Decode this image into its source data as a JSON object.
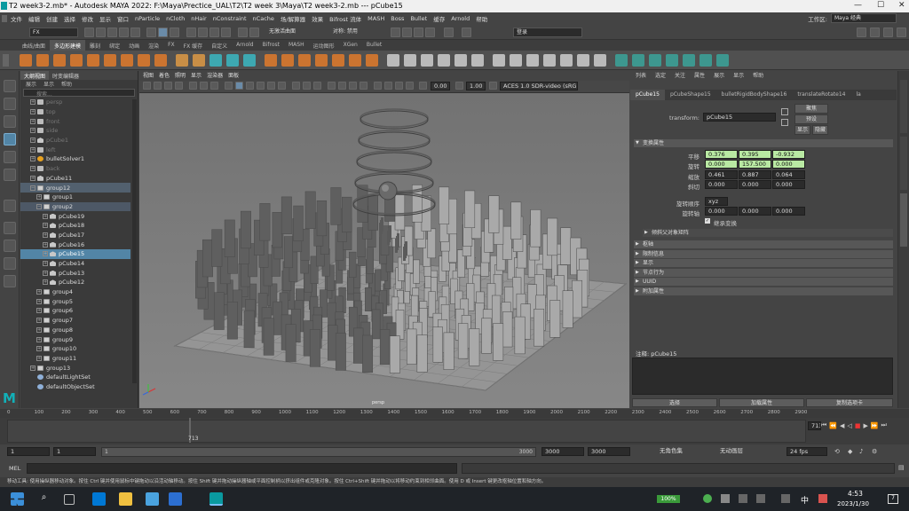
{
  "window": {
    "title": "T2 week3-2.mb* - Autodesk MAYA 2022: F:\\Maya\\Prectice_UAL\\T2\\T2 week 3\\Maya\\T2 week3-2.mb   ---   pCube15",
    "min": "—",
    "max": "☐",
    "close": "✕"
  },
  "menu": {
    "items": [
      "文件",
      "编辑",
      "创建",
      "选择",
      "修改",
      "显示",
      "窗口",
      "nParticle",
      "nCloth",
      "nHair",
      "nConstraint",
      "nCache",
      "场/解算器",
      "效果",
      "Bifrost 流体",
      "MASH",
      "Boss",
      "Bullet",
      "缓存",
      "Arnold",
      "帮助"
    ],
    "workspace_label": "工作区:",
    "workspace_value": "Maya 经典"
  },
  "status": {
    "mode": "FX",
    "live": "无激活曲面",
    "symmetry": "对称: 禁用",
    "login": "登录"
  },
  "shelf": {
    "tabs": [
      "曲线/曲面",
      "多边形建模",
      "雕刻",
      "绑定",
      "动画",
      "渲染",
      "FX",
      "FX 缓存",
      "自定义",
      "Arnold",
      "Bifrost",
      "MASH",
      "运动图形",
      "XGen",
      "Bullet"
    ],
    "active": 1
  },
  "outliner": {
    "tabs": [
      "大纲视图",
      "时变编辑器"
    ],
    "menu": [
      "展示",
      "显示",
      "帮助"
    ],
    "search_placeholder": "搜索...",
    "items": [
      {
        "label": "persp",
        "icon": "camera",
        "depth": 1,
        "dim": true
      },
      {
        "label": "top",
        "icon": "camera",
        "depth": 1,
        "dim": true
      },
      {
        "label": "front",
        "icon": "camera",
        "depth": 1,
        "dim": true
      },
      {
        "label": "side",
        "icon": "camera",
        "depth": 1,
        "dim": true
      },
      {
        "label": "pCube1",
        "icon": "mesh",
        "depth": 1,
        "dim": true
      },
      {
        "label": "left",
        "icon": "camera",
        "depth": 1,
        "dim": true
      },
      {
        "label": "bulletSolver1",
        "icon": "bullet",
        "depth": 1
      },
      {
        "label": "back",
        "icon": "camera",
        "depth": 1,
        "dim": true
      },
      {
        "label": "pCube11",
        "icon": "mesh",
        "depth": 1
      },
      {
        "label": "group12",
        "icon": "group",
        "depth": 1,
        "style": "grp",
        "open": true
      },
      {
        "label": "group1",
        "icon": "group",
        "depth": 2
      },
      {
        "label": "group2",
        "icon": "group",
        "depth": 2,
        "style": "grp2",
        "open": true
      },
      {
        "label": "pCube19",
        "icon": "mesh",
        "depth": 3
      },
      {
        "label": "pCube18",
        "icon": "mesh",
        "depth": 3
      },
      {
        "label": "pCube17",
        "icon": "mesh",
        "depth": 3
      },
      {
        "label": "pCube16",
        "icon": "mesh",
        "depth": 3
      },
      {
        "label": "pCube15",
        "icon": "mesh",
        "depth": 3,
        "style": "sel"
      },
      {
        "label": "pCube14",
        "icon": "mesh",
        "depth": 3
      },
      {
        "label": "pCube13",
        "icon": "mesh",
        "depth": 3
      },
      {
        "label": "pCube12",
        "icon": "mesh",
        "depth": 3
      },
      {
        "label": "group4",
        "icon": "group",
        "depth": 2
      },
      {
        "label": "group5",
        "icon": "group",
        "depth": 2
      },
      {
        "label": "group6",
        "icon": "group",
        "depth": 2
      },
      {
        "label": "group7",
        "icon": "group",
        "depth": 2
      },
      {
        "label": "group8",
        "icon": "group",
        "depth": 2
      },
      {
        "label": "group9",
        "icon": "group",
        "depth": 2
      },
      {
        "label": "group10",
        "icon": "group",
        "depth": 2
      },
      {
        "label": "group11",
        "icon": "group",
        "depth": 2
      },
      {
        "label": "group13",
        "icon": "group",
        "depth": 1
      },
      {
        "label": "defaultLightSet",
        "icon": "set",
        "depth": 1
      },
      {
        "label": "defaultObjectSet",
        "icon": "set",
        "depth": 1
      }
    ]
  },
  "viewport": {
    "menu": [
      "视图",
      "着色",
      "照明",
      "显示",
      "渲染器",
      "面板"
    ],
    "exposure": "0.00",
    "gamma": "1.00",
    "colorspace": "ACES 1.0 SDR-video (sRGB)",
    "camera_label": "persp"
  },
  "attr": {
    "menu": [
      "列表",
      "选定",
      "关注",
      "属性",
      "展示",
      "显示",
      "帮助"
    ],
    "tabs": [
      "pCube15",
      "pCubeShape15",
      "bulletRigidBodyShape16",
      "translateRotate14",
      "la"
    ],
    "transform_label": "transform:",
    "transform_value": "pCube15",
    "btn_focus": "聚焦",
    "btn_preset": "预设",
    "btn_show": "显示",
    "btn_hide": "隐藏",
    "section_transform": "变换属性",
    "rows": [
      {
        "label": "平移",
        "values": [
          "0.376",
          "0.395",
          "-0.932"
        ],
        "green": true
      },
      {
        "label": "旋转",
        "values": [
          "0.000",
          "157.500",
          "0.000"
        ],
        "green": true
      },
      {
        "label": "缩放",
        "values": [
          "0.461",
          "0.887",
          "0.064"
        ]
      },
      {
        "label": "斜切",
        "values": [
          "0.000",
          "0.000",
          "0.000"
        ]
      }
    ],
    "rotate_order_label": "旋转顺序",
    "rotate_order_value": "xyz",
    "rotate_axis_label": "旋转轴",
    "rotate_axis_values": [
      "0.000",
      "0.000",
      "0.000"
    ],
    "inherit_label": "继承变换",
    "sub_section": "倾斜父对象矩阵",
    "sections": [
      "枢轴",
      "限制信息",
      "显示",
      "节点行为",
      "UUID",
      "附加属性"
    ],
    "notes_label": "注释: pCube15",
    "bottom_buttons": [
      "选择",
      "加载属性",
      "复制选项卡"
    ]
  },
  "timeline": {
    "ticks": [
      "0",
      "100",
      "200",
      "300",
      "400",
      "500",
      "600",
      "700",
      "800",
      "900",
      "1000",
      "1100",
      "1200",
      "1300",
      "1400",
      "1500",
      "1600",
      "1700",
      "1800",
      "1900",
      "2000",
      "2100",
      "2200",
      "2300",
      "2400",
      "2500",
      "2600",
      "2700",
      "2800",
      "2900"
    ],
    "current": "713",
    "current_field": "713",
    "playback_speed": "24 fps"
  },
  "range": {
    "start": "1",
    "start2": "1",
    "slider_start": "1",
    "slider_end": "3000",
    "end1": "3000",
    "end2": "3000",
    "char_set": "无角色集",
    "anim_layer": "无动画层",
    "fps": "24 fps"
  },
  "cmd": {
    "label": "MEL"
  },
  "help_text": "移动工具: 使用操纵器移动对象。按住 Ctrl 键并使用鼠标中键拖动以沿活动轴移动。按住 Shift 键并拖动操纵器轴或平面控制柄以挤出组件或克隆对象。按住 Ctrl+Shift 键并拖动以将移动约束到相邻曲面。使用 D 或 Insert 键更改枢轴位置和轴方向。",
  "taskbar": {
    "battery": "100%",
    "ime": "中",
    "time": "4:53",
    "date": "2023/1/30",
    "notif": "7"
  }
}
